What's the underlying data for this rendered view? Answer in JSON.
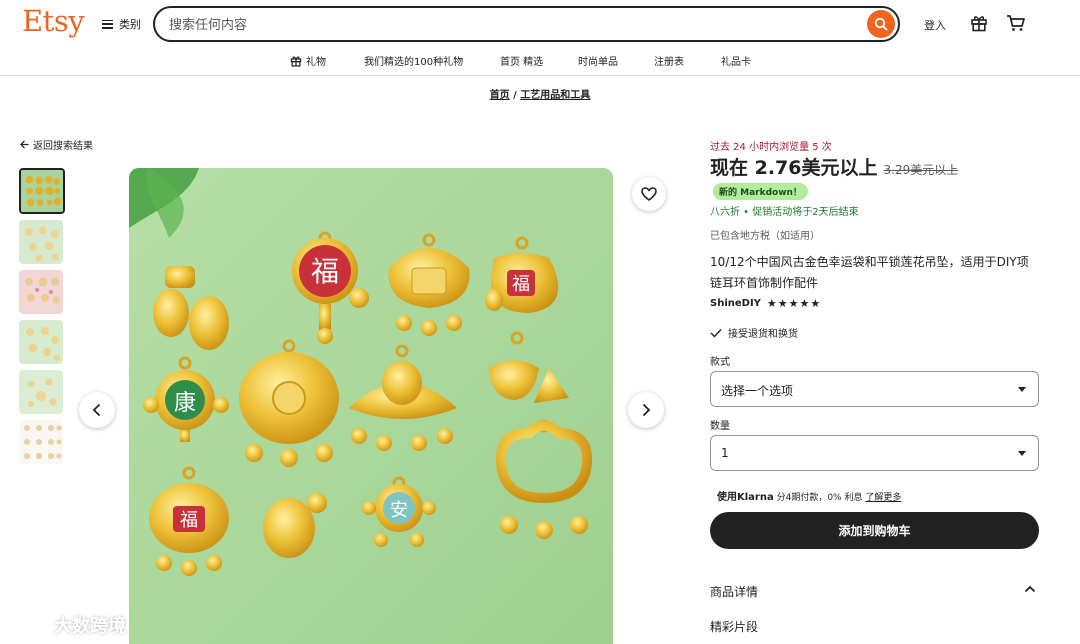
{
  "header": {
    "logo": "Etsy",
    "categories_label": "类别",
    "search_placeholder": "搜索任何内容",
    "signin_label": "登入"
  },
  "nav": {
    "items": [
      {
        "label": "礼物",
        "icon": "gift-icon"
      },
      {
        "label": "我们精选的100种礼物"
      },
      {
        "label": "首页 精选"
      },
      {
        "label": "时尚单品"
      },
      {
        "label": "注册表"
      },
      {
        "label": "礼品卡"
      }
    ]
  },
  "breadcrumb": {
    "home": "首页",
    "separator": "/",
    "category": "工艺用品和工具"
  },
  "back_link": "返回搜索结果",
  "product": {
    "views_note": "过去 24 小时内浏览量 5 次",
    "price_now": "现在 2.76美元以上",
    "price_old": "3.29美元以上",
    "markdown_badge": "新的 Markdown！",
    "discount_note": "八六折 • 促销活动将于2天后结束",
    "tax_note": "已包含地方税（如适用）",
    "title": "10/12个中国风古金色幸运袋和平锁莲花吊坠，适用于DIY项链耳环首饰制作配件",
    "shop_name": "ShineDIY",
    "stars": "★★★★★",
    "rating": 5,
    "returns_note": "接受退货和换货",
    "style_label": "款式",
    "style_value": "选择一个选项",
    "qty_label": "数量",
    "qty_value": "1",
    "klarna_prefix": "使用",
    "klarna_brand": "Klarna",
    "klarna_text": " 分4期付款，0% 利息",
    "klarna_link": "了解更多",
    "add_to_cart": "添加到购物车",
    "details_label": "商品详情",
    "highlights_label": "精彩片段"
  },
  "image_text": {
    "fu": "福",
    "kang": "康",
    "an": "安"
  },
  "watermark": "大数跨境",
  "colors": {
    "brand": "#f1641e",
    "views": "#a61a2e",
    "badge_bg": "#b3ec9d",
    "discount": "#1b7a2e",
    "button": "#222222"
  }
}
